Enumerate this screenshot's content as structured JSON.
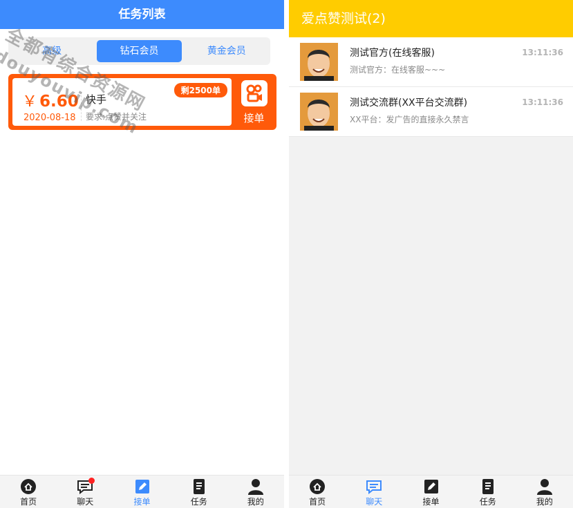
{
  "left": {
    "header_title": "任务列表",
    "tabs": [
      {
        "label": "高级",
        "active": false
      },
      {
        "label": "钻石会员",
        "active": true
      },
      {
        "label": "黄金会员",
        "active": false
      }
    ],
    "task": {
      "currency": "￥",
      "price": "6.60",
      "date": "2020-08-18",
      "platform": "快手",
      "requirement": "要求:点赞并关注",
      "remaining": "剩2500单",
      "take_label": "接单",
      "app_icon": "kuaishou-icon"
    },
    "watermark": {
      "line1": "全都有综合资源网",
      "line2": "douyouvip.com"
    },
    "tabbar": [
      {
        "label": "首页",
        "icon": "home-icon",
        "active": false
      },
      {
        "label": "聊天",
        "icon": "chat-icon",
        "active": false,
        "badge_dot": true
      },
      {
        "label": "接单",
        "icon": "edit-icon",
        "active": true
      },
      {
        "label": "任务",
        "icon": "document-icon",
        "active": false
      },
      {
        "label": "我的",
        "icon": "user-icon",
        "active": false
      }
    ]
  },
  "right": {
    "header_title": "爱点赞测试(2)",
    "chats": [
      {
        "name": "测试官方(在线客服)",
        "message": "测试官方：在线客服~~~",
        "time": "13:11:36"
      },
      {
        "name": "测试交流群(XX平台交流群)",
        "message": "XX平台：发广告的直接永久禁言",
        "time": "13:11:36"
      }
    ],
    "tabbar": [
      {
        "label": "首页",
        "icon": "home-icon",
        "active": false
      },
      {
        "label": "聊天",
        "icon": "chat-icon",
        "active": true
      },
      {
        "label": "接单",
        "icon": "edit-icon",
        "active": false
      },
      {
        "label": "任务",
        "icon": "document-icon",
        "active": false
      },
      {
        "label": "我的",
        "icon": "user-icon",
        "active": false
      }
    ]
  },
  "colors": {
    "blue": "#3d8bfd",
    "orange": "#ff5a0a",
    "yellow": "#ffcc00",
    "badge_red": "#ff2222"
  }
}
